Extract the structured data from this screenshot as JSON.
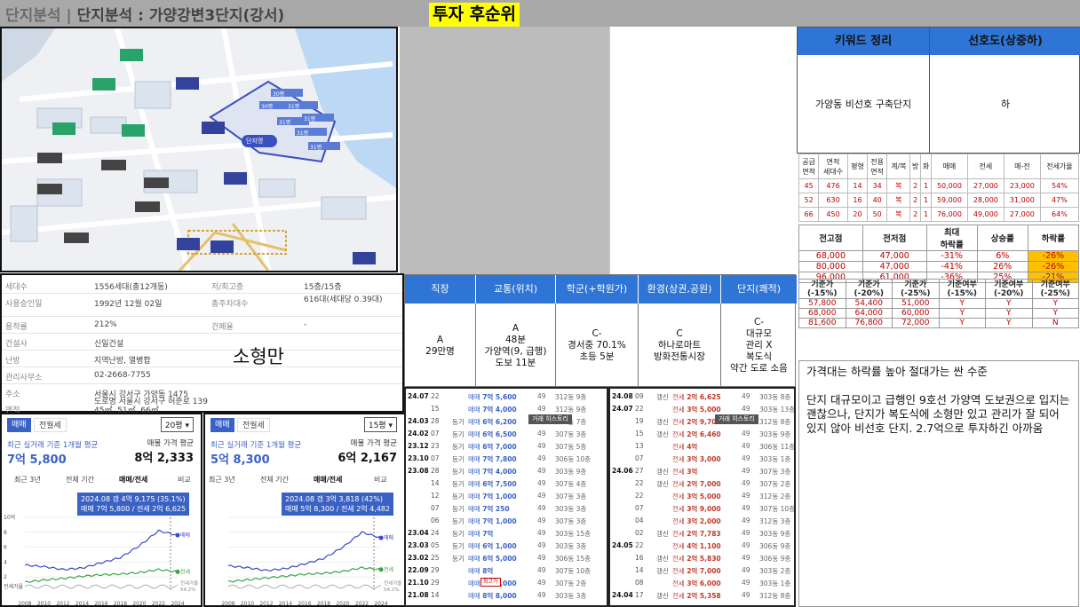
{
  "header": {
    "title_part1": "단지분석",
    "separator": "|",
    "title_part2": "단지분석 : 가양강변3단지(강서)",
    "rank_label": "투자 후순위"
  },
  "map": {
    "apartment_labels": [
      "30평",
      "31평",
      "31평",
      "30평",
      "31평",
      "31평",
      "31평"
    ],
    "building_label": "단지명"
  },
  "info": {
    "rows": [
      {
        "k": "세대수",
        "v": "1556세대(총12개동)",
        "k2": "저/최고층",
        "v2": "15층/15층"
      },
      {
        "k": "사용승인일",
        "v": "1992년 12월 02일",
        "k2": "총주차대수",
        "v2": "616대(세대당 0.39대)"
      },
      {
        "k": "용적률",
        "v": "212%",
        "k2": "건폐율",
        "v2": "-"
      },
      {
        "k": "건설사",
        "v": "신일건설",
        "k2": "",
        "v2": ""
      },
      {
        "k": "난방",
        "v": "지역난방, 열병합",
        "k2": "",
        "v2": ""
      },
      {
        "k": "관리사무소",
        "v": "02-2668-7755",
        "k2": "",
        "v2": ""
      },
      {
        "k": "주소",
        "v": "서울시 강서구 가양동 1475",
        "k2": "",
        "v2": ""
      },
      {
        "k": "",
        "v": "도로명 서울시 강서구 허준로 139",
        "k2": "",
        "v2": ""
      },
      {
        "k": "면적",
        "v": "45㎡, 51㎡, 66㎡",
        "k2": "",
        "v2": ""
      }
    ],
    "note": "소형만"
  },
  "chart_left": {
    "tab1": "매매",
    "tab2": "전월세",
    "select": "20평",
    "cap1": "최근 실거래 기준 1개월 평균",
    "big1": "7억 5,800",
    "cap2": "매물 가격 평균",
    "big2": "8억 2,333",
    "ranges": [
      "최근 3년",
      "전체 기간",
      "매매/전세",
      "비교"
    ],
    "tip1": "2024.08 갭 4억 9,175 (35.1%)",
    "tip2": "매매 7억 5,800 / 전세 2억 6,625",
    "ylabels": [
      "10억",
      "8",
      "6",
      "4",
      "2"
    ],
    "floor_label": "전세가율",
    "series_labels": [
      "매매",
      "전세",
      "전세가율"
    ],
    "ratio_value": "54.2%",
    "xlabels": [
      "2008",
      "2010",
      "2012",
      "2014",
      "2016",
      "2018",
      "2020",
      "2022",
      "2024"
    ]
  },
  "chart_right": {
    "tab1": "매매",
    "tab2": "전월세",
    "select": "15평",
    "cap1": "최근 실거래 기준 1개월 평균",
    "big1": "5억 8,300",
    "cap2": "매물 가격 평균",
    "big2": "6억 2,167",
    "ranges": [
      "최근 3년",
      "전체 기간",
      "매매/전세",
      "비교"
    ],
    "tip1": "2024.08 갭 3억 3,818 (42%)",
    "tip2": "매매 5억 8,300 / 전세 2억 4,482",
    "series_labels": [
      "매매",
      "전세",
      "전세가율"
    ],
    "ratio_value": "54.2%",
    "xlabels": [
      "2008",
      "2010",
      "2012",
      "2014",
      "2016",
      "2018",
      "2020",
      "2022",
      "2024"
    ]
  },
  "chart_data": [
    {
      "type": "line",
      "title": "",
      "x": [
        "2008",
        "2010",
        "2012",
        "2014",
        "2016",
        "2018",
        "2020",
        "2022",
        "2024"
      ],
      "series": [
        {
          "name": "매매",
          "values": [
            3.6,
            3.4,
            3.0,
            3.2,
            3.9,
            4.6,
            6.2,
            8.2,
            7.6
          ]
        },
        {
          "name": "전세",
          "values": [
            1.3,
            1.6,
            1.8,
            2.1,
            2.3,
            2.4,
            2.6,
            3.0,
            2.7
          ]
        }
      ],
      "ylim": [
        0,
        10
      ]
    },
    {
      "type": "line",
      "title": "",
      "x": [
        "2008",
        "2010",
        "2012",
        "2014",
        "2016",
        "2018",
        "2020",
        "2022",
        "2024"
      ],
      "series": [
        {
          "name": "매매",
          "values": [
            2.8,
            2.6,
            2.3,
            2.5,
            3.0,
            3.6,
            4.8,
            6.4,
            5.8
          ]
        },
        {
          "name": "전세",
          "values": [
            1.1,
            1.3,
            1.5,
            1.7,
            1.9,
            2.0,
            2.2,
            2.6,
            2.4
          ]
        }
      ],
      "ylim": [
        0,
        8
      ]
    }
  ],
  "factors": {
    "headers": [
      "직장",
      "교통(위치)",
      "학군(+학원가)",
      "환경(상권,공원)",
      "단지(쾌적)"
    ],
    "cells": [
      [
        "A",
        "29만명"
      ],
      [
        "A",
        "48분",
        "가양역(9, 급행)",
        "도보 11분"
      ],
      [
        "C-",
        "경서중 70.1%",
        "초등 5분"
      ],
      [
        "C",
        "하나로마트",
        "방화전통시장"
      ],
      [
        "C-",
        "대규모",
        "관리 X",
        "복도식",
        "약간 도로 소음"
      ]
    ]
  },
  "tx_left": [
    {
      "d": "24.07",
      "dd": "22",
      "ty": "",
      "pr": "7억 5,600",
      "ar": "49",
      "fl": "312동 9층"
    },
    {
      "d": "",
      "dd": "15",
      "ty": "",
      "pr": "7억 4,000",
      "ar": "49",
      "fl": "312동 9층"
    },
    {
      "d": "24.03",
      "dd": "28",
      "ty": "등기",
      "pr": "6억 6,200",
      "ar": "49",
      "fl": "303동 7층"
    },
    {
      "d": "24.02",
      "dd": "07",
      "ty": "등기",
      "pr": "6억 6,500",
      "ar": "49",
      "fl": "307동 3층"
    },
    {
      "d": "23.12",
      "dd": "23",
      "ty": "등기",
      "pr": "6억 7,000",
      "ar": "49",
      "fl": "307동 5층"
    },
    {
      "d": "23.10",
      "dd": "07",
      "ty": "등기",
      "pr": "7억 7,800",
      "ar": "49",
      "fl": "306동 10층"
    },
    {
      "d": "23.08",
      "dd": "28",
      "ty": "등기",
      "pr": "7억 4,000",
      "ar": "49",
      "fl": "303동 9층"
    },
    {
      "d": "",
      "dd": "14",
      "ty": "등기",
      "pr": "6억 7,500",
      "ar": "49",
      "fl": "307동 4층"
    },
    {
      "d": "",
      "dd": "12",
      "ty": "등기",
      "pr": "7억 1,000",
      "ar": "49",
      "fl": "307동 3층"
    },
    {
      "d": "",
      "dd": "07",
      "ty": "등기",
      "pr": "7억 250",
      "ar": "49",
      "fl": "303동 3층"
    },
    {
      "d": "",
      "dd": "06",
      "ty": "등기",
      "pr": "7억 1,000",
      "ar": "49",
      "fl": "307동 3층"
    },
    {
      "d": "23.04",
      "dd": "24",
      "ty": "등기",
      "pr": "7억",
      "ar": "49",
      "fl": "303동 15층"
    },
    {
      "d": "23.03",
      "dd": "05",
      "ty": "등기",
      "pr": "6억 1,000",
      "ar": "49",
      "fl": "303동 3층"
    },
    {
      "d": "23.02",
      "dd": "25",
      "ty": "등기",
      "pr": "6억 5,000",
      "ar": "49",
      "fl": "306동 15층"
    },
    {
      "d": "22.09",
      "dd": "29",
      "ty": "",
      "pr": "8억",
      "ar": "49",
      "fl": "307동 10층"
    },
    {
      "d": "21.10",
      "dd": "29",
      "ty": "",
      "pr": "9억 6,000",
      "ar": "49",
      "fl": "307동 2층"
    },
    {
      "d": "21.08",
      "dd": "14",
      "ty": "",
      "pr": "8억 8,000",
      "ar": "49",
      "fl": "303동 3층"
    }
  ],
  "tx_right": [
    {
      "d": "24.08",
      "dd": "09",
      "ty": "갱신",
      "pr": "2억 6,625",
      "ar": "49",
      "fl": "303동 8층"
    },
    {
      "d": "24.07",
      "dd": "22",
      "ty": "",
      "pr": "3억 5,000",
      "ar": "49",
      "fl": "303동 13층"
    },
    {
      "d": "",
      "dd": "19",
      "ty": "갱신",
      "pr": "2억 9,700",
      "ar": "49",
      "fl": "312동 8층"
    },
    {
      "d": "",
      "dd": "15",
      "ty": "갱신",
      "pr": "2억 6,460",
      "ar": "49",
      "fl": "303동 9층"
    },
    {
      "d": "",
      "dd": "13",
      "ty": "",
      "pr": "4억",
      "ar": "49",
      "fl": "306동 11층"
    },
    {
      "d": "",
      "dd": "07",
      "ty": "",
      "pr": "3억 3,000",
      "ar": "49",
      "fl": "303동 1층"
    },
    {
      "d": "24.06",
      "dd": "27",
      "ty": "갱신",
      "pr": "3억",
      "ar": "49",
      "fl": "307동 3층"
    },
    {
      "d": "",
      "dd": "22",
      "ty": "갱신",
      "pr": "2억 7,000",
      "ar": "49",
      "fl": "307동 2층"
    },
    {
      "d": "",
      "dd": "22",
      "ty": "",
      "pr": "3억 5,000",
      "ar": "49",
      "fl": "312동 2층"
    },
    {
      "d": "",
      "dd": "07",
      "ty": "",
      "pr": "3억 9,000",
      "ar": "49",
      "fl": "307동 10층"
    },
    {
      "d": "",
      "dd": "04",
      "ty": "",
      "pr": "3억 2,000",
      "ar": "49",
      "fl": "312동 3층"
    },
    {
      "d": "",
      "dd": "02",
      "ty": "갱신",
      "pr": "2억 7,783",
      "ar": "49",
      "fl": "303동 9층"
    },
    {
      "d": "24.05",
      "dd": "22",
      "ty": "",
      "pr": "4억 1,100",
      "ar": "49",
      "fl": "306동 9층"
    },
    {
      "d": "",
      "dd": "16",
      "ty": "갱신",
      "pr": "2억 5,830",
      "ar": "49",
      "fl": "306동 9층"
    },
    {
      "d": "",
      "dd": "14",
      "ty": "갱신",
      "pr": "2억 7,000",
      "ar": "49",
      "fl": "303동 2층"
    },
    {
      "d": "",
      "dd": "08",
      "ty": "",
      "pr": "3억 6,000",
      "ar": "49",
      "fl": "303동 1층"
    },
    {
      "d": "24.04",
      "dd": "17",
      "ty": "갱신",
      "pr": "2억 5,358",
      "ar": "49",
      "fl": "312동 8층"
    }
  ],
  "tx_common": {
    "sale": "매매",
    "jeonse": "전세",
    "history": "거래 히스토리",
    "recent": "최고가"
  },
  "keyword": {
    "h1": "키워드 정리",
    "h2": "선호도(상중하)",
    "b1": "가양동 비선호 구축단지",
    "b2": "하"
  },
  "units": {
    "headers": [
      "공급\n면적",
      "면적\n세대수",
      "평형",
      "전용\n면적",
      "계/복",
      "방",
      "화",
      "매매",
      "전세",
      "매-전",
      "전세가율"
    ],
    "rows": [
      [
        "45",
        "476",
        "14",
        "34",
        "복",
        "2",
        "1",
        "50,000",
        "27,000",
        "23,000",
        "54%"
      ],
      [
        "52",
        "630",
        "16",
        "40",
        "복",
        "2",
        "1",
        "59,000",
        "28,000",
        "31,000",
        "47%"
      ],
      [
        "66",
        "450",
        "20",
        "50",
        "복",
        "2",
        "1",
        "76,000",
        "49,000",
        "27,000",
        "64%"
      ]
    ]
  },
  "prices": {
    "headers": [
      "전고점",
      "전저점",
      "최대\n하락률",
      "상승률",
      "하락률"
    ],
    "rows": [
      [
        "68,000",
        "47,000",
        "-31%",
        "6%",
        "-26%"
      ],
      [
        "80,000",
        "47,000",
        "-41%",
        "26%",
        "-26%"
      ],
      [
        "96,000",
        "61,000",
        "-36%",
        "25%",
        "-21%"
      ]
    ]
  },
  "ranges": {
    "headers": [
      "기준가\n(-15%)",
      "기준가\n(-20%)",
      "기준가\n(-25%)",
      "기준여부\n(-15%)",
      "기준여부\n(-20%)",
      "기준여부\n(-25%)"
    ],
    "rows": [
      [
        "57,800",
        "54,400",
        "51,000",
        "Y",
        "Y",
        "Y"
      ],
      [
        "68,000",
        "64,000",
        "60,000",
        "Y",
        "Y",
        "Y"
      ],
      [
        "81,600",
        "76,800",
        "72,000",
        "Y",
        "Y",
        "N"
      ]
    ]
  },
  "memo": {
    "p1": "가격대는 하락률 높아 절대가는 싼 수준",
    "p2": "단지 대규모이고 급행인 9호선 가양역 도보권으로 입지는 괜찮으나, 단지가 복도식에 소형만 있고 관리가 잘 되어 있지 않아 비선호 단지. 2.7억으로 투자하긴 아까움"
  },
  "colors": {
    "accent": "#2e75d6",
    "brand_blue": "#3a62c4",
    "highlight": "#ffff00",
    "warn": "#ffc000",
    "red": "#c00000"
  }
}
